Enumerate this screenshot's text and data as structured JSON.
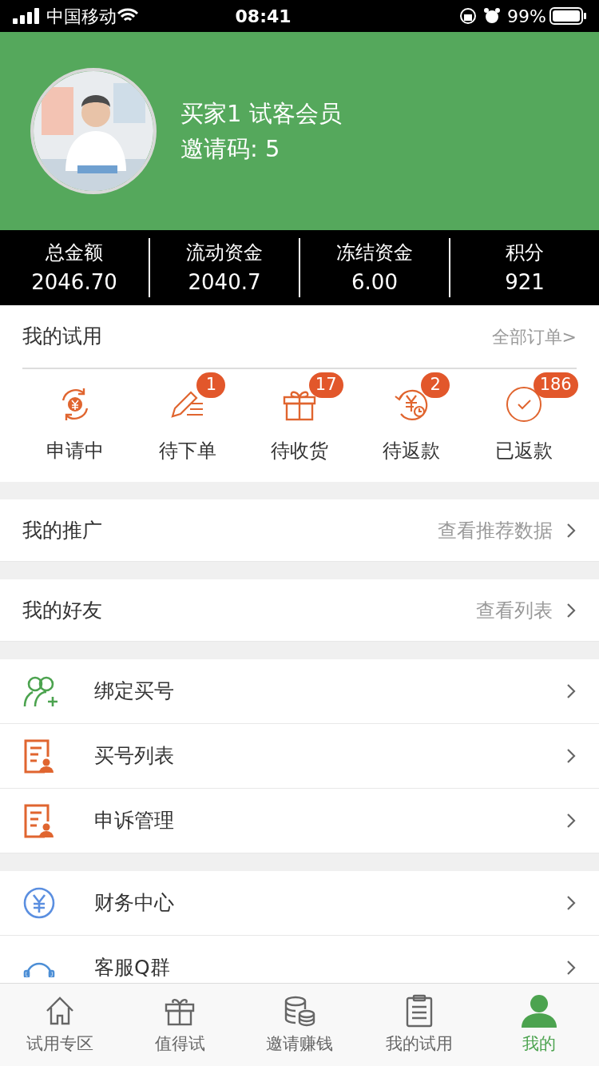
{
  "status_bar": {
    "carrier": "中国移动",
    "time": "08:41",
    "battery": "99%"
  },
  "profile": {
    "name": "买家1 试客会员",
    "invite": "邀请码: 5"
  },
  "stats": [
    {
      "label": "总金额",
      "value": "2046.70"
    },
    {
      "label": "流动资金",
      "value": "2040.7"
    },
    {
      "label": "冻结资金",
      "value": "6.00"
    },
    {
      "label": "积分",
      "value": "921"
    }
  ],
  "my_trial": {
    "title": "我的试用",
    "link": "全部订单>",
    "items": [
      {
        "label": "申请中"
      },
      {
        "label": "待下单",
        "badge": "1"
      },
      {
        "label": "待收货",
        "badge": "17"
      },
      {
        "label": "待返款",
        "badge": "2"
      },
      {
        "label": "已返款",
        "badge": "186"
      }
    ]
  },
  "link_rows": [
    {
      "label": "我的推广",
      "link": "查看推荐数据"
    },
    {
      "label": "我的好友",
      "link": "查看列表"
    }
  ],
  "menu_groups": [
    [
      {
        "label": "绑定买号"
      },
      {
        "label": "买号列表"
      },
      {
        "label": "申诉管理"
      }
    ],
    [
      {
        "label": "财务中心"
      },
      {
        "label": "客服Q群"
      }
    ]
  ],
  "tab_bar": [
    {
      "label": "试用专区",
      "selected": false
    },
    {
      "label": "值得试",
      "selected": false
    },
    {
      "label": "邀请赚钱",
      "selected": false
    },
    {
      "label": "我的试用",
      "selected": false
    },
    {
      "label": "我的",
      "selected": true
    }
  ]
}
